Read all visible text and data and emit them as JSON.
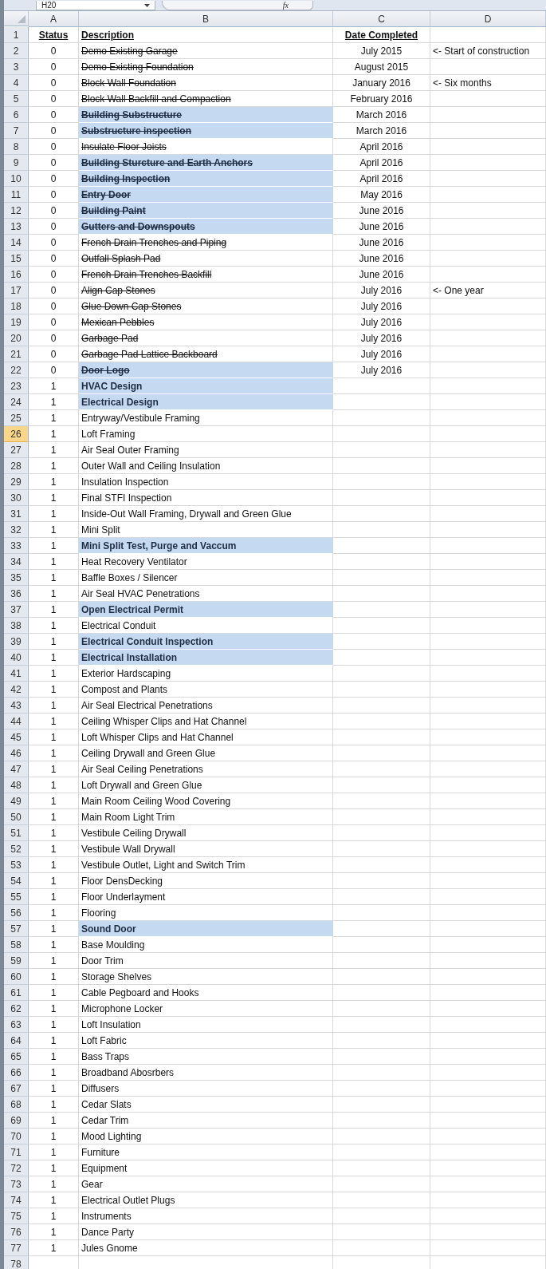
{
  "name_box": "H20",
  "formula_label": "fx",
  "columns": [
    "A",
    "B",
    "C",
    "D"
  ],
  "header": {
    "number": "1",
    "status": "Status",
    "description": "Description",
    "date": "Date Completed"
  },
  "rows": [
    {
      "number": "2",
      "status": "0",
      "description": "Demo Existing Garage",
      "date": "July 2015",
      "note": "<- Start of construction",
      "done": true,
      "highlighted": false,
      "selected": false
    },
    {
      "number": "3",
      "status": "0",
      "description": "Demo Existing Foundation",
      "date": "August 2015",
      "done": true,
      "highlighted": false,
      "selected": false
    },
    {
      "number": "4",
      "status": "0",
      "description": "Block Wall Foundation",
      "date": "January 2016",
      "note": "<- Six months",
      "done": true,
      "highlighted": false,
      "selected": false
    },
    {
      "number": "5",
      "status": "0",
      "description": "Block Wall Backfill and Compaction",
      "date": "February 2016",
      "done": true,
      "highlighted": false,
      "selected": false
    },
    {
      "number": "6",
      "status": "0",
      "description": "Building Substructure",
      "date": "March 2016",
      "done": true,
      "highlighted": true,
      "selected": false
    },
    {
      "number": "7",
      "status": "0",
      "description": "Substructure inspection",
      "date": "March 2016",
      "done": true,
      "highlighted": true,
      "selected": false
    },
    {
      "number": "8",
      "status": "0",
      "description": "Insulate Floor Joists",
      "date": "April 2016",
      "done": true,
      "highlighted": false,
      "selected": false
    },
    {
      "number": "9",
      "status": "0",
      "description": "Building Sturcture and Earth Anchors",
      "date": "April 2016",
      "done": true,
      "highlighted": true,
      "selected": false
    },
    {
      "number": "10",
      "status": "0",
      "description": "Building Inspection",
      "date": "April 2016",
      "done": true,
      "highlighted": true,
      "selected": false
    },
    {
      "number": "11",
      "status": "0",
      "description": "Entry Door",
      "date": "May 2016",
      "done": true,
      "highlighted": true,
      "selected": false
    },
    {
      "number": "12",
      "status": "0",
      "description": "Building Paint",
      "date": "June 2016",
      "done": true,
      "highlighted": true,
      "selected": false
    },
    {
      "number": "13",
      "status": "0",
      "description": "Gutters and Downspouts",
      "date": "June 2016",
      "done": true,
      "highlighted": true,
      "selected": false
    },
    {
      "number": "14",
      "status": "0",
      "description": "French Drain Trenches and Piping",
      "date": "June 2016",
      "done": true,
      "highlighted": false,
      "selected": false
    },
    {
      "number": "15",
      "status": "0",
      "description": "Outfall Splash Pad",
      "date": "June 2016",
      "done": true,
      "highlighted": false,
      "selected": false
    },
    {
      "number": "16",
      "status": "0",
      "description": "French Drain Trenches Backfill",
      "date": "June 2016",
      "done": true,
      "highlighted": false,
      "selected": false
    },
    {
      "number": "17",
      "status": "0",
      "description": "Align Cap Stones",
      "date": "July 2016",
      "note": "<- One year",
      "done": true,
      "highlighted": false,
      "selected": false
    },
    {
      "number": "18",
      "status": "0",
      "description": "Glue Down Cap Stones",
      "date": "July 2016",
      "done": true,
      "highlighted": false,
      "selected": false
    },
    {
      "number": "19",
      "status": "0",
      "description": "Mexican Pebbles",
      "date": "July 2016",
      "done": true,
      "highlighted": false,
      "selected": false
    },
    {
      "number": "20",
      "status": "0",
      "description": "Garbage Pad",
      "date": "July 2016",
      "done": true,
      "highlighted": false,
      "selected": false
    },
    {
      "number": "21",
      "status": "0",
      "description": "Garbage Pad Lattice Backboard",
      "date": "July 2016",
      "done": true,
      "highlighted": false,
      "selected": false
    },
    {
      "number": "22",
      "status": "0",
      "description": "Door Logo",
      "date": "July 2016",
      "done": true,
      "highlighted": true,
      "selected": false
    },
    {
      "number": "23",
      "status": "1",
      "description": "HVAC Design",
      "done": false,
      "highlighted": true,
      "selected": false
    },
    {
      "number": "24",
      "status": "1",
      "description": "Electrical Design",
      "done": false,
      "highlighted": true,
      "selected": false
    },
    {
      "number": "25",
      "status": "1",
      "description": "Entryway/Vestibule Framing",
      "done": false,
      "highlighted": false,
      "selected": false
    },
    {
      "number": "26",
      "status": "1",
      "description": "Loft Framing",
      "done": false,
      "highlighted": false,
      "selected": true
    },
    {
      "number": "27",
      "status": "1",
      "description": "Air Seal Outer Framing",
      "done": false,
      "highlighted": false,
      "selected": false
    },
    {
      "number": "28",
      "status": "1",
      "description": "Outer Wall and Ceiling Insulation",
      "done": false,
      "highlighted": false,
      "selected": false
    },
    {
      "number": "29",
      "status": "1",
      "description": "Insulation Inspection",
      "done": false,
      "highlighted": false,
      "selected": false
    },
    {
      "number": "30",
      "status": "1",
      "description": "Final STFI Inspection",
      "done": false,
      "highlighted": false,
      "selected": false
    },
    {
      "number": "31",
      "status": "1",
      "description": "Inside-Out Wall Framing, Drywall and Green Glue",
      "done": false,
      "highlighted": false,
      "selected": false
    },
    {
      "number": "32",
      "status": "1",
      "description": "Mini Split",
      "done": false,
      "highlighted": false,
      "selected": false
    },
    {
      "number": "33",
      "status": "1",
      "description": "Mini Split Test, Purge and Vaccum",
      "done": false,
      "highlighted": true,
      "selected": false
    },
    {
      "number": "34",
      "status": "1",
      "description": "Heat Recovery Ventilator",
      "done": false,
      "highlighted": false,
      "selected": false
    },
    {
      "number": "35",
      "status": "1",
      "description": "Baffle Boxes / Silencer",
      "done": false,
      "highlighted": false,
      "selected": false
    },
    {
      "number": "36",
      "status": "1",
      "description": "Air Seal HVAC Penetrations",
      "done": false,
      "highlighted": false,
      "selected": false
    },
    {
      "number": "37",
      "status": "1",
      "description": "Open Electrical Permit",
      "done": false,
      "highlighted": true,
      "selected": false
    },
    {
      "number": "38",
      "status": "1",
      "description": "Electrical Conduit",
      "done": false,
      "highlighted": false,
      "selected": false
    },
    {
      "number": "39",
      "status": "1",
      "description": "Electrical Conduit Inspection",
      "done": false,
      "highlighted": true,
      "selected": false
    },
    {
      "number": "40",
      "status": "1",
      "description": "Electrical Installation",
      "done": false,
      "highlighted": true,
      "selected": false
    },
    {
      "number": "41",
      "status": "1",
      "description": "Exterior Hardscaping",
      "done": false,
      "highlighted": false,
      "selected": false
    },
    {
      "number": "42",
      "status": "1",
      "description": "Compost and Plants",
      "done": false,
      "highlighted": false,
      "selected": false
    },
    {
      "number": "43",
      "status": "1",
      "description": "Air Seal Electrical Penetrations",
      "done": false,
      "highlighted": false,
      "selected": false
    },
    {
      "number": "44",
      "status": "1",
      "description": "Ceiling Whisper Clips and Hat Channel",
      "done": false,
      "highlighted": false,
      "selected": false
    },
    {
      "number": "45",
      "status": "1",
      "description": "Loft Whisper Clips and Hat Channel",
      "done": false,
      "highlighted": false,
      "selected": false
    },
    {
      "number": "46",
      "status": "1",
      "description": "Ceiling Drywall and Green Glue",
      "done": false,
      "highlighted": false,
      "selected": false
    },
    {
      "number": "47",
      "status": "1",
      "description": "Air Seal Ceiling Penetrations",
      "done": false,
      "highlighted": false,
      "selected": false
    },
    {
      "number": "48",
      "status": "1",
      "description": "Loft Drywall and Green Glue",
      "done": false,
      "highlighted": false,
      "selected": false
    },
    {
      "number": "49",
      "status": "1",
      "description": "Main Room Ceiling Wood Covering",
      "done": false,
      "highlighted": false,
      "selected": false
    },
    {
      "number": "50",
      "status": "1",
      "description": "Main Room Light Trim",
      "done": false,
      "highlighted": false,
      "selected": false
    },
    {
      "number": "51",
      "status": "1",
      "description": "Vestibule Ceiling Drywall",
      "done": false,
      "highlighted": false,
      "selected": false
    },
    {
      "number": "52",
      "status": "1",
      "description": "Vestibule Wall Drywall",
      "done": false,
      "highlighted": false,
      "selected": false
    },
    {
      "number": "53",
      "status": "1",
      "description": "Vestibule Outlet, Light and Switch Trim",
      "done": false,
      "highlighted": false,
      "selected": false
    },
    {
      "number": "54",
      "status": "1",
      "description": "Floor DensDecking",
      "done": false,
      "highlighted": false,
      "selected": false
    },
    {
      "number": "55",
      "status": "1",
      "description": "Floor Underlayment",
      "done": false,
      "highlighted": false,
      "selected": false
    },
    {
      "number": "56",
      "status": "1",
      "description": "Flooring",
      "done": false,
      "highlighted": false,
      "selected": false
    },
    {
      "number": "57",
      "status": "1",
      "description": "Sound Door",
      "done": false,
      "highlighted": true,
      "selected": false
    },
    {
      "number": "58",
      "status": "1",
      "description": "Base Moulding",
      "done": false,
      "highlighted": false,
      "selected": false
    },
    {
      "number": "59",
      "status": "1",
      "description": "Door Trim",
      "done": false,
      "highlighted": false,
      "selected": false
    },
    {
      "number": "60",
      "status": "1",
      "description": "Storage Shelves",
      "done": false,
      "highlighted": false,
      "selected": false
    },
    {
      "number": "61",
      "status": "1",
      "description": "Cable Pegboard and Hooks",
      "done": false,
      "highlighted": false,
      "selected": false
    },
    {
      "number": "62",
      "status": "1",
      "description": "Microphone Locker",
      "done": false,
      "highlighted": false,
      "selected": false
    },
    {
      "number": "63",
      "status": "1",
      "description": "Loft Insulation",
      "done": false,
      "highlighted": false,
      "selected": false
    },
    {
      "number": "64",
      "status": "1",
      "description": "Loft Fabric",
      "done": false,
      "highlighted": false,
      "selected": false
    },
    {
      "number": "65",
      "status": "1",
      "description": "Bass Traps",
      "done": false,
      "highlighted": false,
      "selected": false
    },
    {
      "number": "66",
      "status": "1",
      "description": "Broadband Abosrbers",
      "done": false,
      "highlighted": false,
      "selected": false
    },
    {
      "number": "67",
      "status": "1",
      "description": "Diffusers",
      "done": false,
      "highlighted": false,
      "selected": false
    },
    {
      "number": "68",
      "status": "1",
      "description": "Cedar Slats",
      "done": false,
      "highlighted": false,
      "selected": false
    },
    {
      "number": "69",
      "status": "1",
      "description": "Cedar Trim",
      "done": false,
      "highlighted": false,
      "selected": false
    },
    {
      "number": "70",
      "status": "1",
      "description": "Mood Lighting",
      "done": false,
      "highlighted": false,
      "selected": false
    },
    {
      "number": "71",
      "status": "1",
      "description": "Furniture",
      "done": false,
      "highlighted": false,
      "selected": false
    },
    {
      "number": "72",
      "status": "1",
      "description": "Equipment",
      "done": false,
      "highlighted": false,
      "selected": false
    },
    {
      "number": "73",
      "status": "1",
      "description": "Gear",
      "done": false,
      "highlighted": false,
      "selected": false
    },
    {
      "number": "74",
      "status": "1",
      "description": "Electrical Outlet Plugs",
      "done": false,
      "highlighted": false,
      "selected": false
    },
    {
      "number": "75",
      "status": "1",
      "description": "Instruments",
      "done": false,
      "highlighted": false,
      "selected": false
    },
    {
      "number": "76",
      "status": "1",
      "description": "Dance Party",
      "done": false,
      "highlighted": false,
      "selected": false
    },
    {
      "number": "77",
      "status": "1",
      "description": "Jules Gnome",
      "done": false,
      "highlighted": false,
      "selected": false
    },
    {
      "number": "78",
      "selected": false
    }
  ]
}
